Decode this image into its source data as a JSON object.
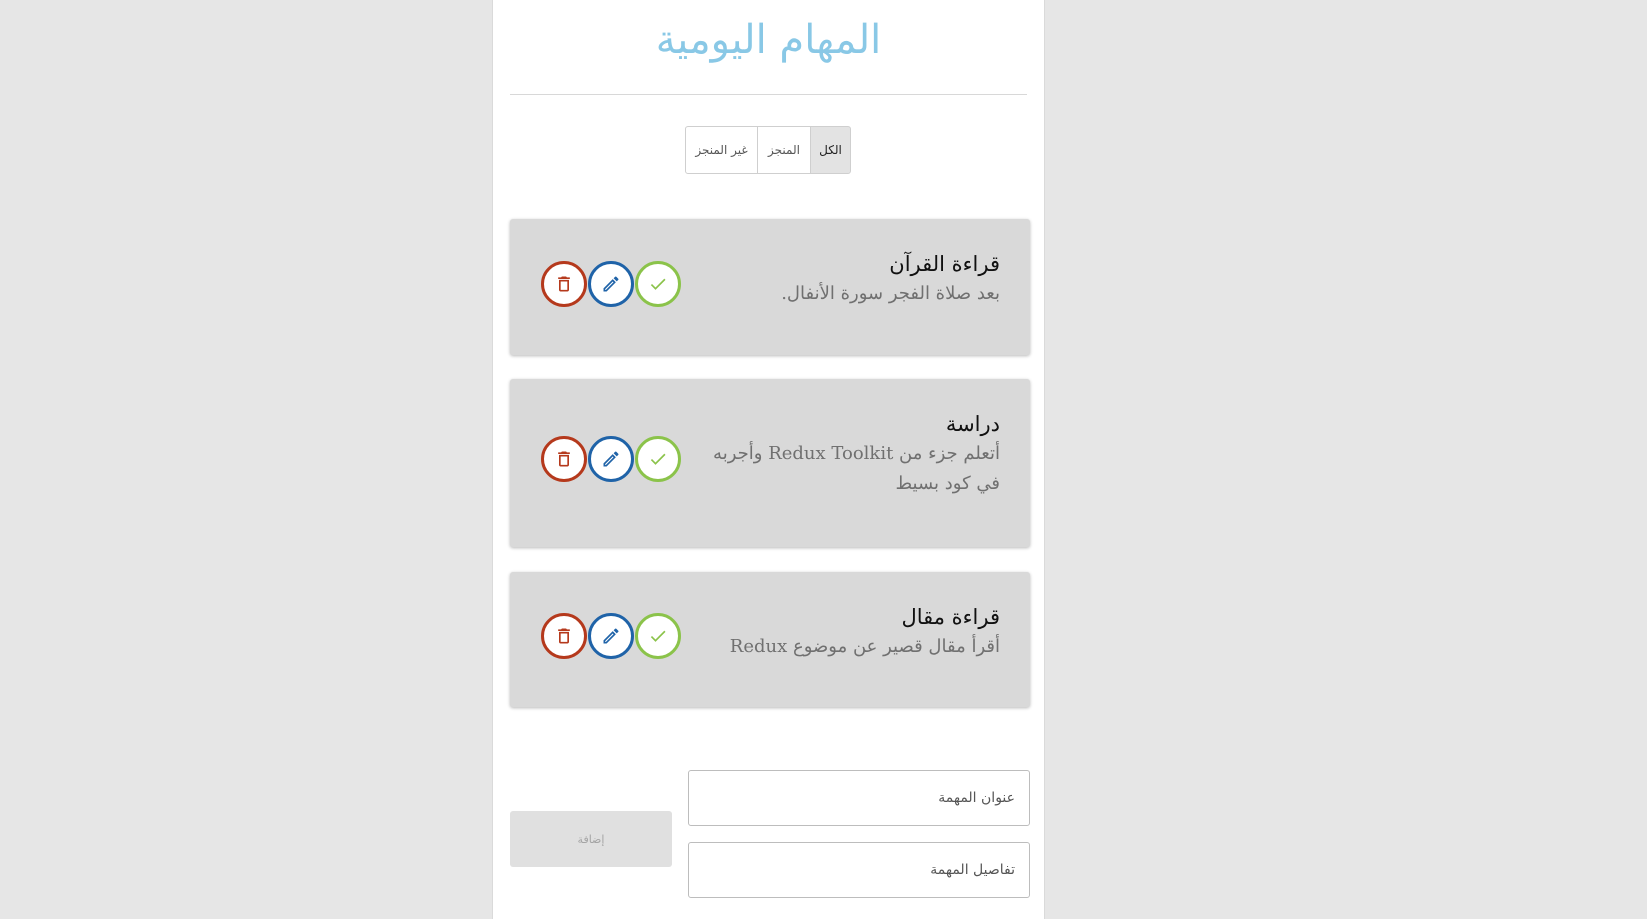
{
  "header": {
    "title": "المهام اليومية"
  },
  "filters": {
    "all_label": "الكل",
    "done_label": "المنجز",
    "not_done_label": "غير المنجز",
    "selected": "الكل"
  },
  "tasks": [
    {
      "title": "قراءة القرآن",
      "details": "بعد صلاة الفجر سورة الأنفال."
    },
    {
      "title": "دراسة",
      "details": "أتعلم جزء من Redux Toolkit وأجربه في كود بسيط"
    },
    {
      "title": "قراءة مقال",
      "details": "أقرأ مقال قصير عن موضوع Redux"
    }
  ],
  "icons": {
    "delete": "trash-icon",
    "edit": "pencil-icon",
    "complete": "check-icon"
  },
  "colors": {
    "title": "#89c8e6",
    "delete": "#b5391c",
    "edit": "#1f63a8",
    "complete": "#8bc34a",
    "card_background": "#d9d9d9"
  },
  "form": {
    "title_placeholder": "عنوان المهمة",
    "details_placeholder": "تفاصيل المهمة",
    "add_label": "إضافة"
  }
}
